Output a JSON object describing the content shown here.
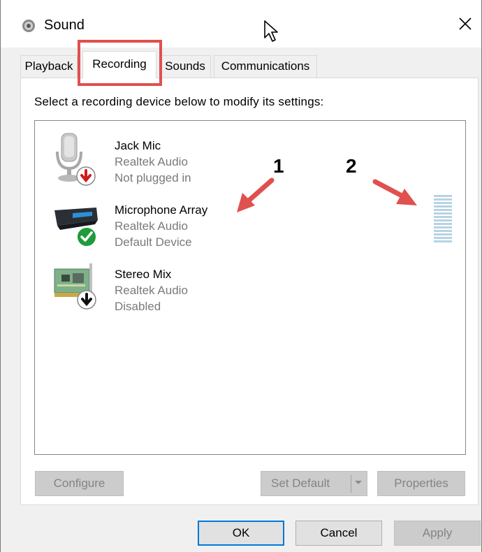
{
  "window": {
    "title": "Sound"
  },
  "tabs": [
    {
      "label": "Playback"
    },
    {
      "label": "Recording"
    },
    {
      "label": "Sounds"
    },
    {
      "label": "Communications"
    }
  ],
  "instruction": "Select a recording device below to modify its settings:",
  "devices": [
    {
      "name": "Jack Mic",
      "driver": "Realtek Audio",
      "status": "Not plugged in",
      "icon": "jack-mic-icon",
      "badge": "unplugged-red-arrow-icon"
    },
    {
      "name": "Microphone Array",
      "driver": "Realtek Audio",
      "status": "Default Device",
      "icon": "microphone-array-icon",
      "badge": "default-device-check-icon"
    },
    {
      "name": "Stereo Mix",
      "driver": "Realtek Audio",
      "status": "Disabled",
      "icon": "sound-card-icon",
      "badge": "disabled-down-arrow-icon"
    }
  ],
  "annotations": {
    "label1": "1",
    "label2": "2",
    "color": "#e0504e"
  },
  "buttons": {
    "configure": "Configure",
    "set_default": "Set Default",
    "properties": "Properties",
    "ok": "OK",
    "cancel": "Cancel",
    "apply": "Apply"
  },
  "colors": {
    "accent": "#0078d7",
    "highlight": "#e0504e",
    "meter": "#b6d3e4"
  }
}
